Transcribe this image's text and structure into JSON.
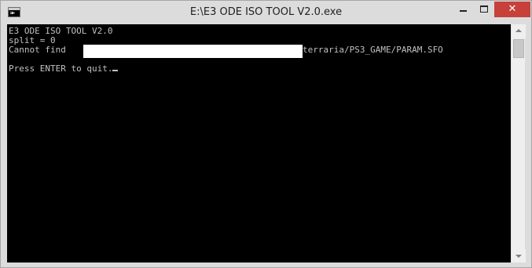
{
  "window": {
    "title": "E:\\E3 ODE ISO TOOL V2.0.exe",
    "controls": {
      "minimize_icon": "minimize-icon",
      "maximize_icon": "maximize-icon",
      "close_label": "✕"
    },
    "colors": {
      "close_button": "#c7403a",
      "console_background": "#000000",
      "console_text": "#c0c0c0"
    }
  },
  "console": {
    "lines": {
      "header": "E3 ODE ISO TOOL V2.0",
      "split": "split = 0",
      "error_prefix": "Cannot find",
      "error_path_suffix": "terraria/PS3_GAME/PARAM.SFO",
      "prompt": "Press ENTER to quit."
    }
  }
}
